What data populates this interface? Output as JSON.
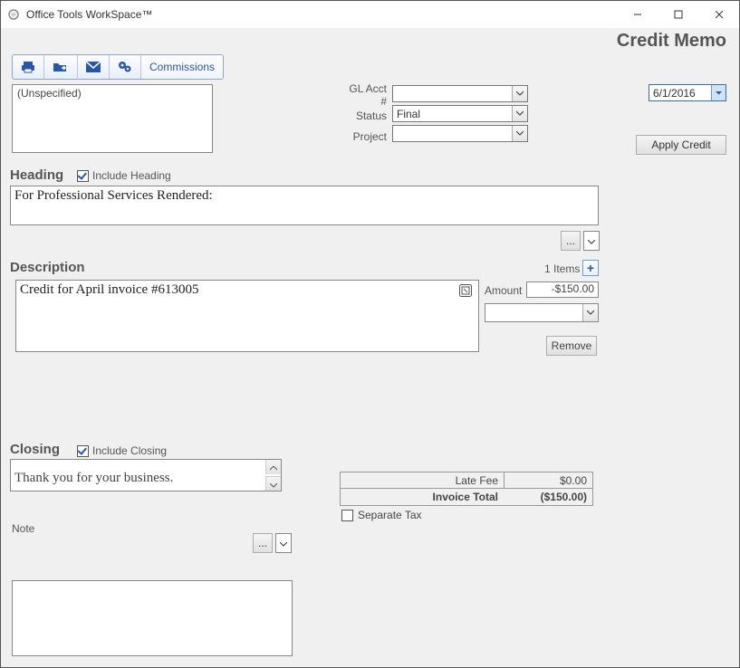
{
  "window": {
    "title": "Office Tools WorkSpace™"
  },
  "page_title": "Credit Memo",
  "toolbar": {
    "commissions_label": "Commissions"
  },
  "unspecified_text": "(Unspecified)",
  "meta": {
    "gl_label": "GL Acct #",
    "status_label": "Status",
    "project_label": "Project",
    "gl_value": "",
    "status_value": "Final",
    "project_value": ""
  },
  "date_value": "6/1/2016",
  "apply_credit_label": "Apply Credit",
  "heading": {
    "label": "Heading",
    "include_label": "Include Heading",
    "include_checked": true,
    "text": "For Professional Services Rendered:"
  },
  "description": {
    "label": "Description",
    "items_count_text": "1 Items",
    "text": "Credit for April invoice #613005",
    "amount_label": "Amount",
    "amount_value": "-$150.00",
    "remove_label": "Remove"
  },
  "closing": {
    "label": "Closing",
    "include_label": "Include Closing",
    "include_checked": true,
    "text": "Thank you for your business."
  },
  "totals": {
    "late_fee_label": "Late Fee",
    "late_fee_value": "$0.00",
    "invoice_total_label": "Invoice Total",
    "invoice_total_value": "($150.00)",
    "separate_tax_label": "Separate Tax",
    "separate_tax_checked": false
  },
  "note": {
    "label": "Note"
  }
}
